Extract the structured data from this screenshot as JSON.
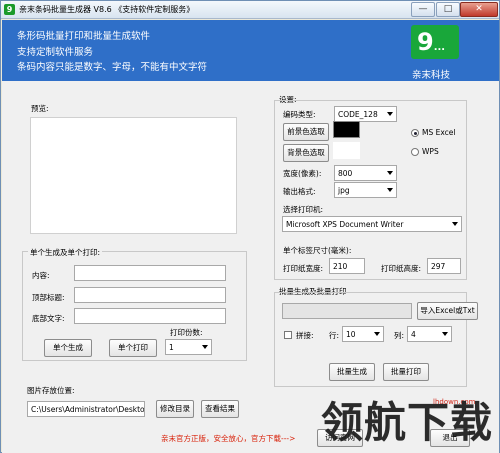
{
  "window": {
    "title": "亲末条码批量生成器 V8.6 《支持软件定制服务》",
    "app_icon": "app-logo-icon",
    "minimize": "—",
    "maximize": "□",
    "close": "✕"
  },
  "banner": {
    "lines": [
      "条形码批量打印和批量生成软件",
      "支持定制软件服务",
      "条码内容只能是数字、字母，不能有中文字符"
    ],
    "logo_text": "亲末科技",
    "logo_glyph": "9",
    "logo_dots": "...",
    "colors": {
      "banner": "#2f6fc8",
      "logo": "#19a73a"
    }
  },
  "preview": {
    "label": "预览:"
  },
  "single": {
    "group_title": "单个生成及单个打印:",
    "content_label": "内容:",
    "content_value": "",
    "top_label": "顶部标题:",
    "top_value": "",
    "bottom_label": "底部文字:",
    "bottom_value": "",
    "copies_label": "打印份数:",
    "copies_value": "1",
    "generate_button": "单个生成",
    "print_button": "单个打印"
  },
  "storage": {
    "label": "图片存放位置:",
    "path": "C:\\Users\\Administrator\\Desktop",
    "change_button": "修改目录",
    "view_button": "查看结果"
  },
  "settings": {
    "group_title": "设置:",
    "code_type_label": "编码类型:",
    "code_type_value": "CODE_128",
    "fg_button": "前景色选取",
    "fg_color": "#000000",
    "bg_button": "背景色选取",
    "bg_color": "#ffffff",
    "ms_excel": "MS  Excel",
    "wps": "WPS",
    "width_label": "宽度(像素):",
    "width_value": "800",
    "format_label": "输出格式:",
    "format_value": "jpg",
    "printer_label": "选择打印机:",
    "printer_value": "Microsoft XPS Document Writer",
    "label_size_title": "单个标签尺寸(毫米):",
    "print_width_label": "打印纸宽度:",
    "print_width_value": "210",
    "print_height_label": "打印纸高度:",
    "print_height_value": "297"
  },
  "batch": {
    "group_title": "批量生成及批量打印",
    "file_value": "",
    "import_button": "导入Excel或Txt",
    "tile_label": "拼接:",
    "row_label": "行:",
    "row_value": "10",
    "col_label": "列:",
    "col_value": "4",
    "generate_button": "批量生成",
    "print_button": "批量打印"
  },
  "footer": {
    "notice": "亲末官方正版，安全放心，官方下载--->",
    "visit_button": "访问官网",
    "exit_button": "退出"
  },
  "watermark": {
    "text": "领航下载",
    "url": "lhdown.com"
  }
}
